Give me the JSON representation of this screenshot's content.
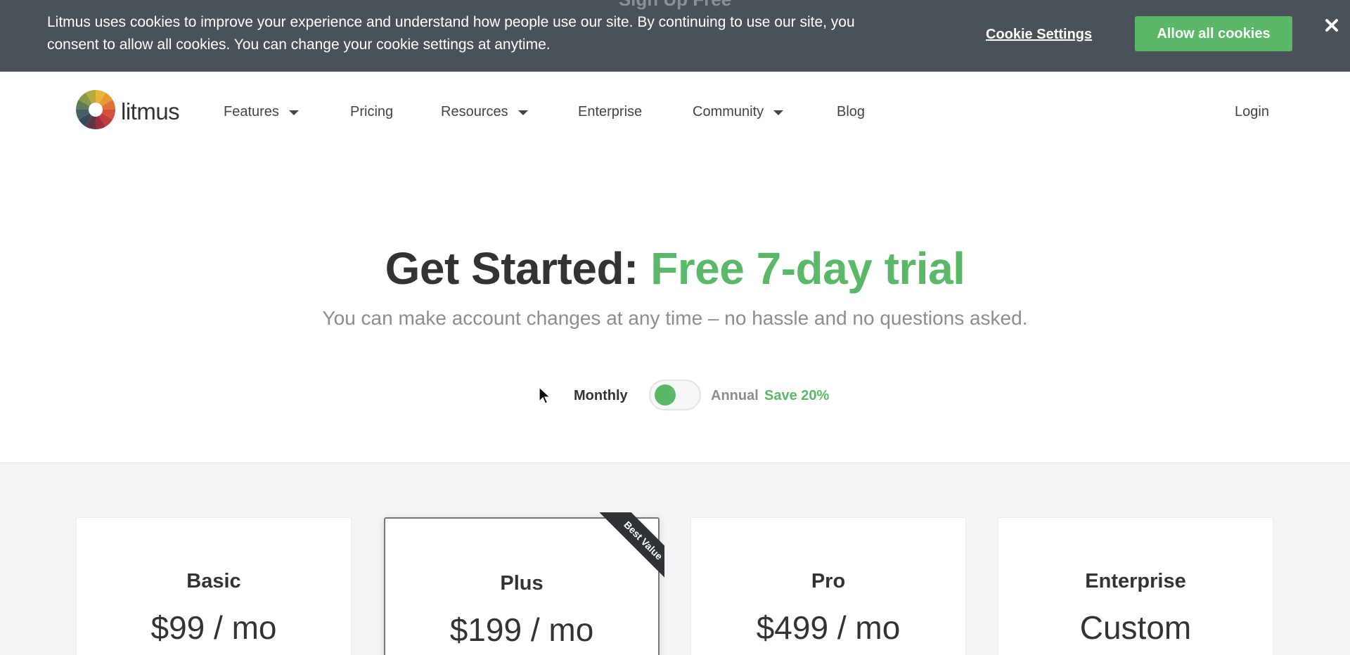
{
  "cookie_banner": {
    "ghost_text": "Sign Up Free",
    "message": "Litmus uses cookies to improve your experience and understand how people use our site. By continuing to use our site, you consent to allow all cookies. You can change your cookie settings at anytime.",
    "settings_label": "Cookie Settings",
    "allow_label": "Allow all cookies",
    "close_icon": "close-icon"
  },
  "nav": {
    "logo_text": "litmus",
    "items": [
      {
        "label": "Features",
        "has_dropdown": true
      },
      {
        "label": "Pricing",
        "has_dropdown": false
      },
      {
        "label": "Resources",
        "has_dropdown": true
      },
      {
        "label": "Enterprise",
        "has_dropdown": false
      },
      {
        "label": "Community",
        "has_dropdown": true
      },
      {
        "label": "Blog",
        "has_dropdown": false
      }
    ],
    "login_label": "Login"
  },
  "hero": {
    "title_prefix": "Get Started:",
    "title_highlight": "Free 7-day trial",
    "subtitle": "You can make account changes at any time – no hassle and no questions asked."
  },
  "billing": {
    "monthly_label": "Monthly",
    "annual_label": "Annual",
    "save_label": "Save 20%",
    "selected": "Monthly"
  },
  "plans": [
    {
      "name": "Basic",
      "price": "$99 / mo"
    },
    {
      "name": "Plus",
      "price": "$199 / mo",
      "ribbon": "Best Value"
    },
    {
      "name": "Pro",
      "price": "$499 / mo"
    },
    {
      "name": "Enterprise",
      "price": "Custom"
    }
  ],
  "colors": {
    "accent_green": "#5ab868",
    "banner_bg": "#4a5158",
    "text_dark": "#333333",
    "text_muted": "#8d8d8d"
  }
}
